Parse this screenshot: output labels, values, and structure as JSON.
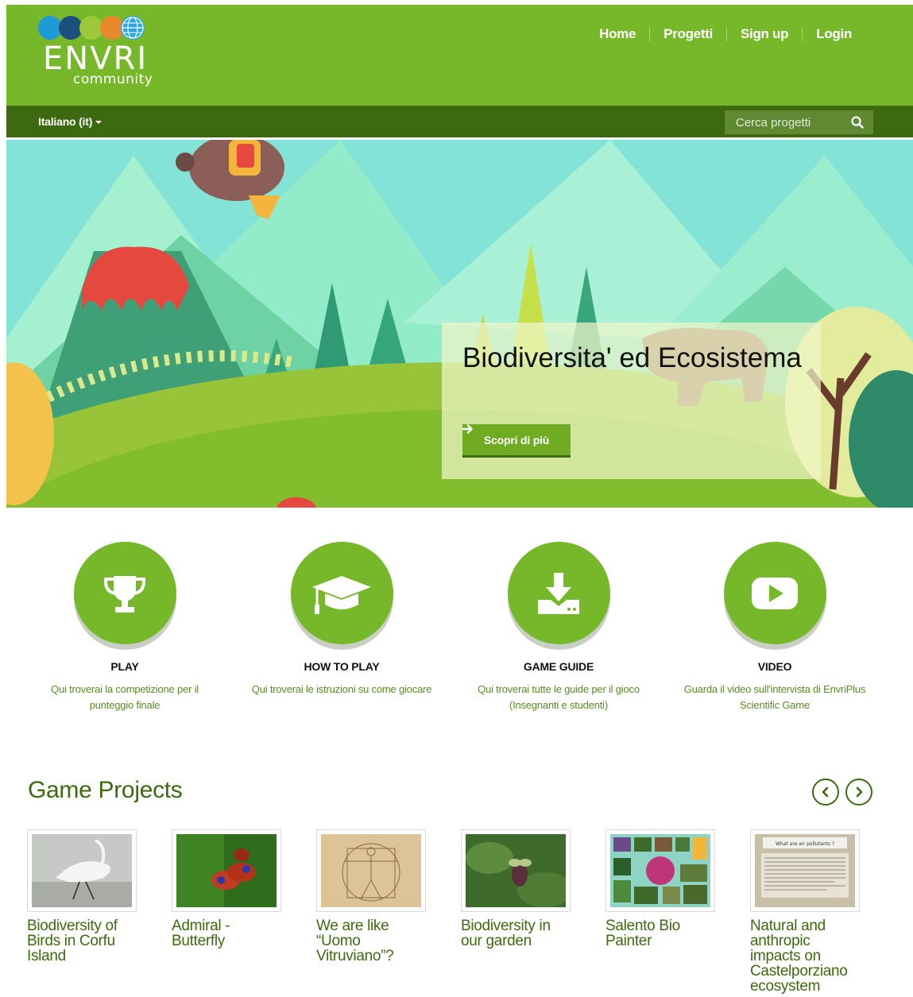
{
  "header": {
    "logo_text": "ENVRI",
    "logo_sub": "community",
    "nav": [
      {
        "label": "Home"
      },
      {
        "label": "Progetti"
      },
      {
        "label": "Sign up"
      },
      {
        "label": "Login"
      }
    ]
  },
  "subbar": {
    "language": "Italiano (it)",
    "search_placeholder": "Cerca progetti",
    "search_icon": "search-icon"
  },
  "hero": {
    "title": "Biodiversita' ed Ecosistema",
    "button_label": "Scopri di più",
    "button_icon": "arrow-right-icon"
  },
  "features": [
    {
      "icon": "trophy-icon",
      "title": "PLAY",
      "desc": "Qui troverai la competizione per il punteggio finale"
    },
    {
      "icon": "graduation-cap-icon",
      "title": "HOW TO PLAY",
      "desc": "Qui troverai le istruzioni su come giocare"
    },
    {
      "icon": "download-icon",
      "title": "GAME GUIDE",
      "desc": "Qui troverai tutte le guide per il gioco (Insegnanti e studenti)"
    },
    {
      "icon": "play-video-icon",
      "title": "VIDEO",
      "desc": "Guarda il video sull'intervista di EnvriPlus Scientific Game"
    }
  ],
  "game_projects": {
    "title": "Game Projects",
    "items": [
      {
        "title": "Biodiversity of Birds in Corfu Island"
      },
      {
        "title": "Admiral - Butterfly"
      },
      {
        "title": "We are like “Uomo Vitruviano”?"
      },
      {
        "title": "Biodiversity in our garden"
      },
      {
        "title": "Salento Bio Painter"
      },
      {
        "title": "Natural and anthropic impacts on Castelporziano ecosystem"
      }
    ],
    "thumb6_heading": "What are air pollutants ?"
  },
  "colors": {
    "brand_green": "#77b82b",
    "dark_green": "#3d6a10",
    "text_green": "#5c8a24"
  }
}
